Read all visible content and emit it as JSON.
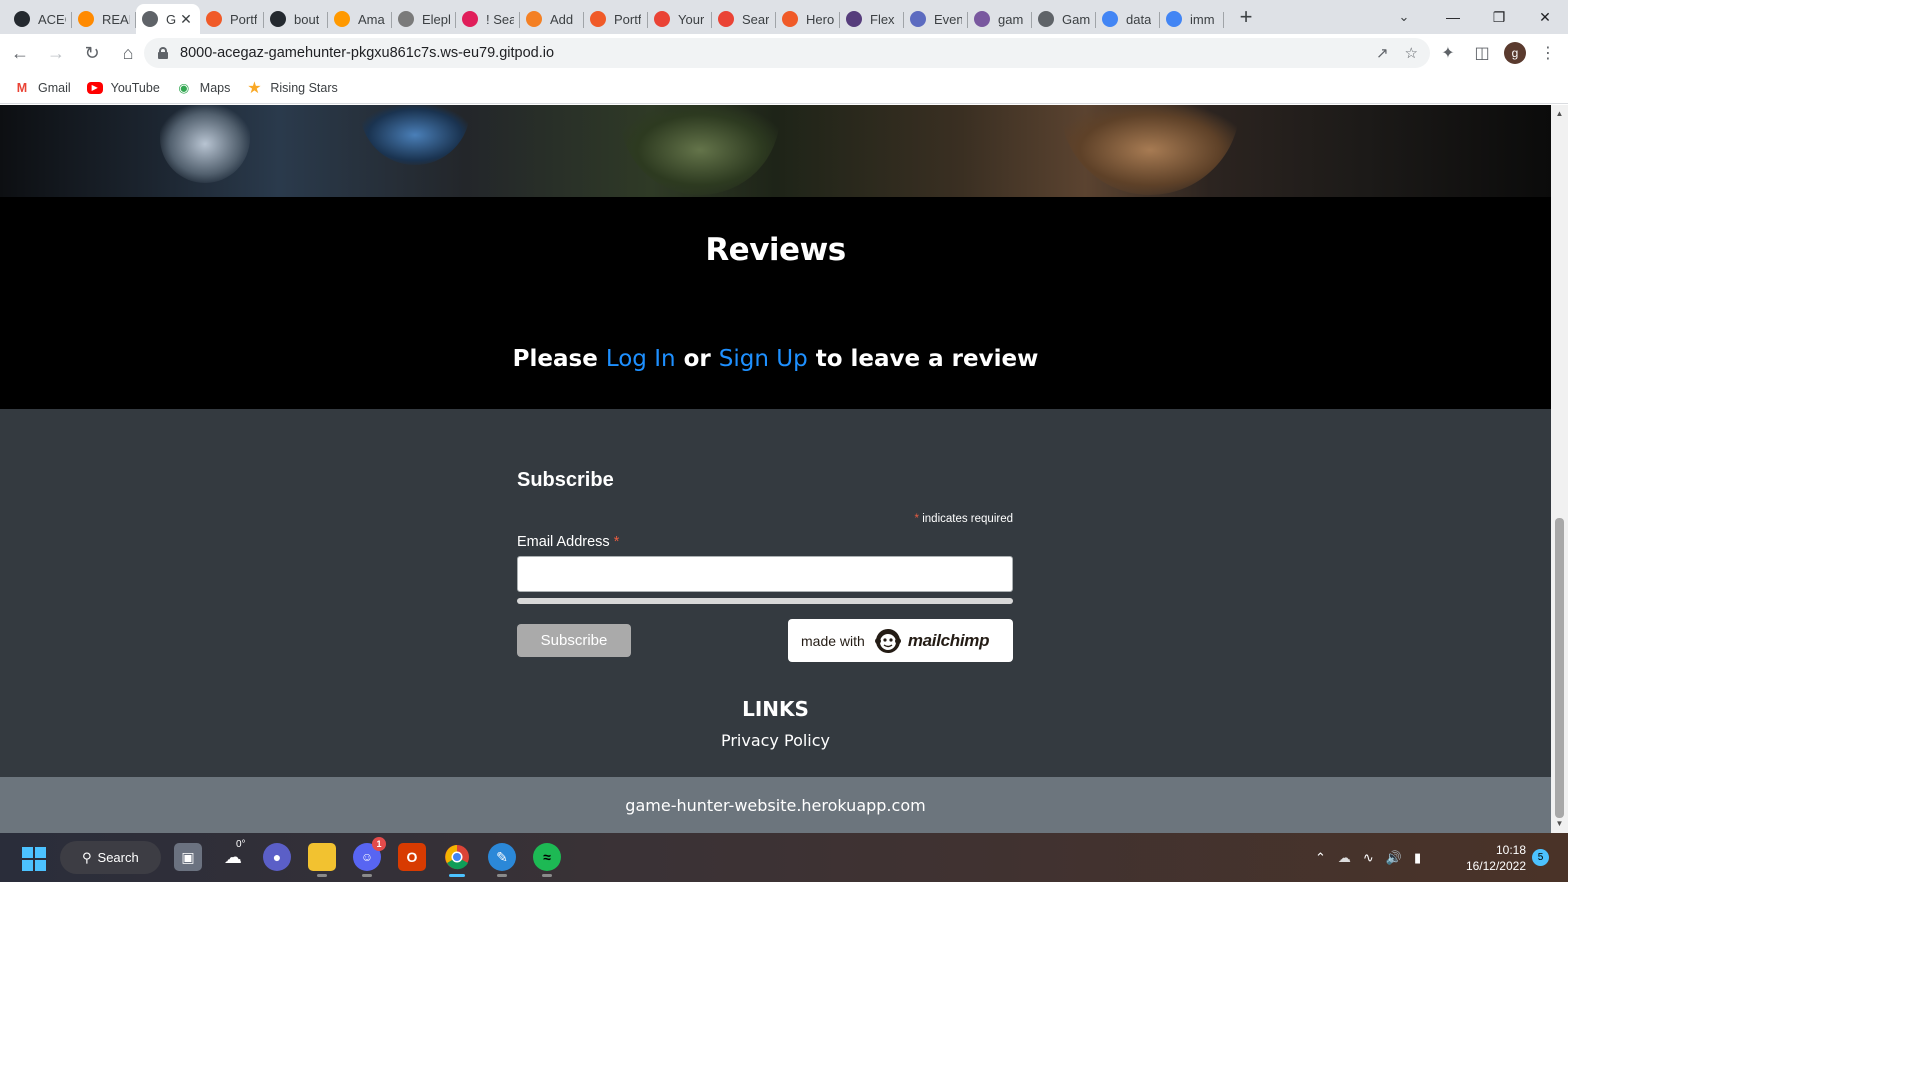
{
  "browser": {
    "tabs": [
      {
        "label": "ACEG",
        "favicon": "github-icon",
        "color": "#24292f"
      },
      {
        "label": "READ",
        "favicon": "gitpod-icon",
        "color": "#ff8a00"
      },
      {
        "label": "G",
        "favicon": "globe-icon",
        "color": "#5f6368",
        "active": true
      },
      {
        "label": "Portf",
        "favicon": "codeinstitute-icon",
        "color": "#f05a28"
      },
      {
        "label": "bout",
        "favicon": "github-icon",
        "color": "#24292f"
      },
      {
        "label": "Ama",
        "favicon": "box-icon",
        "color": "#ff9900"
      },
      {
        "label": "Elepl",
        "favicon": "elephant-icon",
        "color": "#7a7a7a"
      },
      {
        "label": "! Sea",
        "favicon": "slack-icon",
        "color": "#e01e5a"
      },
      {
        "label": "Add",
        "favicon": "stackoverflow-icon",
        "color": "#f48024"
      },
      {
        "label": "Portf",
        "favicon": "codeinstitute-icon",
        "color": "#f05a28"
      },
      {
        "label": "Your",
        "favicon": "gmail-icon",
        "color": "#ea4335"
      },
      {
        "label": "Sear",
        "favicon": "gmail-icon",
        "color": "#ea4335"
      },
      {
        "label": "Hero",
        "favicon": "codeinstitute-icon",
        "color": "#f05a28"
      },
      {
        "label": "Flex",
        "favicon": "bootstrap-icon",
        "color": "#563d7c"
      },
      {
        "label": "Even",
        "favicon": "s-icon",
        "color": "#5c6bc0"
      },
      {
        "label": "gam",
        "favicon": "heroku-icon",
        "color": "#79589f"
      },
      {
        "label": "Gam",
        "favicon": "globe-icon",
        "color": "#5f6368"
      },
      {
        "label": "data",
        "favicon": "google-icon",
        "color": "#4285f4"
      },
      {
        "label": "imm",
        "favicon": "google-icon",
        "color": "#4285f4"
      }
    ],
    "new_tab_label": "+",
    "url": "8000-acegaz-gamehunter-pkgxu861c7s.ws-eu79.gitpod.io",
    "avatar_letter": "g",
    "bookmarks": [
      {
        "label": "Gmail",
        "icon": "gmail-icon",
        "color": "#ea4335"
      },
      {
        "label": "YouTube",
        "icon": "youtube-icon",
        "color": "#ff0000"
      },
      {
        "label": "Maps",
        "icon": "maps-icon",
        "color": "#34a853"
      },
      {
        "label": "Rising Stars",
        "icon": "star-icon",
        "color": "#f9a825"
      }
    ]
  },
  "page": {
    "reviews_title": "Reviews",
    "cta": {
      "prefix": "Please",
      "login": "Log In",
      "middle": "or",
      "signup": "Sign Up",
      "suffix": "to leave a review"
    },
    "subscribe": {
      "title": "Subscribe",
      "required_asterisk": "*",
      "required_note": "indicates required",
      "email_label": "Email Address",
      "email_value": "",
      "button_label": "Subscribe",
      "badge_made_with": "made with",
      "badge_brand": "mailchimp"
    },
    "links_title": "LINKS",
    "links": [
      "Privacy Policy"
    ],
    "footer_text": "game-hunter-website.herokuapp.com"
  },
  "taskbar": {
    "search_label": "Search",
    "weather": "0°",
    "discord_badge": "1",
    "time": "10:18",
    "date": "16/12/2022",
    "notification_count": "5"
  }
}
